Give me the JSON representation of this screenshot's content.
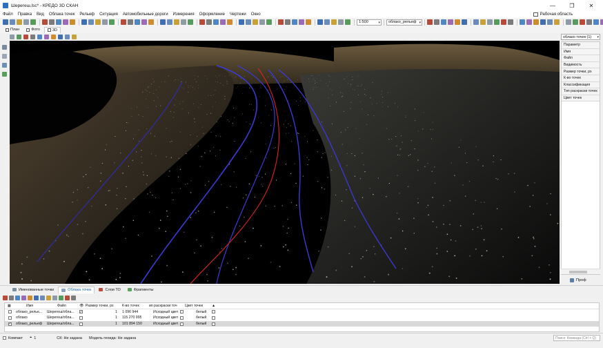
{
  "window": {
    "title": "Шерегеш.lsc* - КРЕДО 3D СКАН",
    "minimize": "—",
    "maximize": "❐",
    "close": "✕"
  },
  "menu": [
    "Файл",
    "Правка",
    "Вид",
    "Облака точек",
    "Рельеф",
    "Ситуация",
    "Автомобильные дороги",
    "Измерения",
    "Оформление",
    "Чертежи",
    "Окно"
  ],
  "workspace_label": "Рабочая область",
  "toolbar": {
    "scale": "1:500",
    "layer": "облако_рельеф"
  },
  "view_tabs": [
    "План",
    "Фото",
    "3D"
  ],
  "view_tabs_active": 2,
  "properties": {
    "selector": "облако точек (1)",
    "rows": [
      "Параметр",
      "Имя",
      "Файл",
      "Видимость",
      "Размер точки, px",
      "К-во точек",
      "Классификация",
      "Тип раскраски точек",
      "Цвет точек"
    ]
  },
  "profile_tab": "Проф",
  "bottom_tabs": [
    "Именованные точки",
    "Облака точек",
    "Слои ТО",
    "Фрагменты"
  ],
  "bottom_tabs_active": 1,
  "table": {
    "headers": [
      "Имя",
      "Файл",
      "Размер точки, px",
      "К-во точек",
      "ип раскраски точ",
      "Цвет точек"
    ],
    "rows": [
      {
        "name": "облако_релье...",
        "file": "Шерегеш/обла...",
        "point_size": "1",
        "count": "1 096 944",
        "coloring": "Исходный цвет",
        "color": "белый",
        "checked": false,
        "visible": true
      },
      {
        "name": "облако",
        "file": "Шерегеш/обла...",
        "point_size": "1",
        "count": "115 270 995",
        "coloring": "Исходный цвет",
        "color": "белый",
        "checked": false,
        "visible": false
      },
      {
        "name": "облако_рельеф",
        "file": "Шерегеш/обла...",
        "point_size": "1",
        "count": "101 894 150",
        "coloring": "Исходный цвет",
        "color": "белый",
        "checked": true,
        "visible": false
      }
    ]
  },
  "status": {
    "mode": "Компакт",
    "snap": "1",
    "cs": "СК: Не задана",
    "geoid": "Модель геоида: Не задана",
    "command_placeholder": "Поиск: Команда (Ctrl + Q)"
  },
  "colors": {
    "viewport_bg": "#000000",
    "axis_line": "#e02020",
    "edge_lines": "#3a3ad8",
    "active_tab": "#1a64b8"
  }
}
